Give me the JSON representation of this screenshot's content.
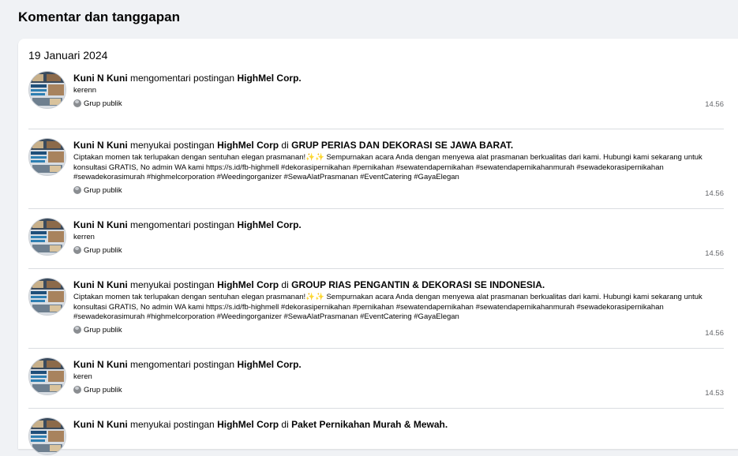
{
  "page": {
    "title": "Komentar dan tanggapan"
  },
  "date_header": "19 Januari 2024",
  "colors": {
    "background": "#f0f2f5",
    "card": "#ffffff",
    "divider": "#dadde1",
    "muted": "#65676b"
  },
  "items": [
    {
      "actor": "Kuni N Kuni",
      "verb": "mengomentari postingan",
      "target": "HighMel Corp.",
      "connector": "",
      "group": "",
      "text": "kerenn",
      "privacy": "Grup publik",
      "time": "14.56"
    },
    {
      "actor": "Kuni N Kuni",
      "verb": "menyukai postingan",
      "target": "HighMel Corp",
      "connector": "di",
      "group": "GRUP PERIAS DAN DEKORASI SE JAWA BARAT.",
      "text": "Ciptakan momen tak terlupakan dengan sentuhan elegan prasmanan!✨✨ Sempurnakan acara Anda dengan menyewa alat prasmanan berkualitas dari kami. Hubungi kami sekarang untuk konsultasi GRATIS, No admin WA kami https://s.id/fb-highmell #dekorasipernikahan #pernikahan #sewatendapernikahan #sewatendapernikahanmurah #sewadekorasipernikahan #sewadekorasimurah #highmelcorporation #Weedingorganizer #SewaAlatPrasmanan #EventCatering #GayaElegan",
      "privacy": "Grup publik",
      "time": "14.56"
    },
    {
      "actor": "Kuni N Kuni",
      "verb": "mengomentari postingan",
      "target": "HighMel Corp.",
      "connector": "",
      "group": "",
      "text": "kerren",
      "privacy": "Grup publik",
      "time": "14.56"
    },
    {
      "actor": "Kuni N Kuni",
      "verb": "menyukai postingan",
      "target": "HighMel Corp",
      "connector": "di",
      "group": "GROUP RIAS PENGANTIN & DEKORASI SE INDONESIA.",
      "text": "Ciptakan momen tak terlupakan dengan sentuhan elegan prasmanan!✨✨ Sempurnakan acara Anda dengan menyewa alat prasmanan berkualitas dari kami. Hubungi kami sekarang untuk konsultasi GRATIS, No admin WA kami https://s.id/fb-highmell #dekorasipernikahan #pernikahan #sewatendapernikahan #sewatendapernikahanmurah #sewadekorasipernikahan #sewadekorasimurah #highmelcorporation #Weedingorganizer #SewaAlatPrasmanan #EventCatering #GayaElegan",
      "privacy": "Grup publik",
      "time": "14.56"
    },
    {
      "actor": "Kuni N Kuni",
      "verb": "mengomentari postingan",
      "target": "HighMel Corp.",
      "connector": "",
      "group": "",
      "text": "keren",
      "privacy": "Grup publik",
      "time": "14.53"
    },
    {
      "actor": "Kuni N Kuni",
      "verb": "menyukai postingan",
      "target": "HighMel Corp",
      "connector": "di",
      "group": "Paket Pernikahan Murah & Mewah.",
      "text": "",
      "privacy": "",
      "time": ""
    }
  ]
}
